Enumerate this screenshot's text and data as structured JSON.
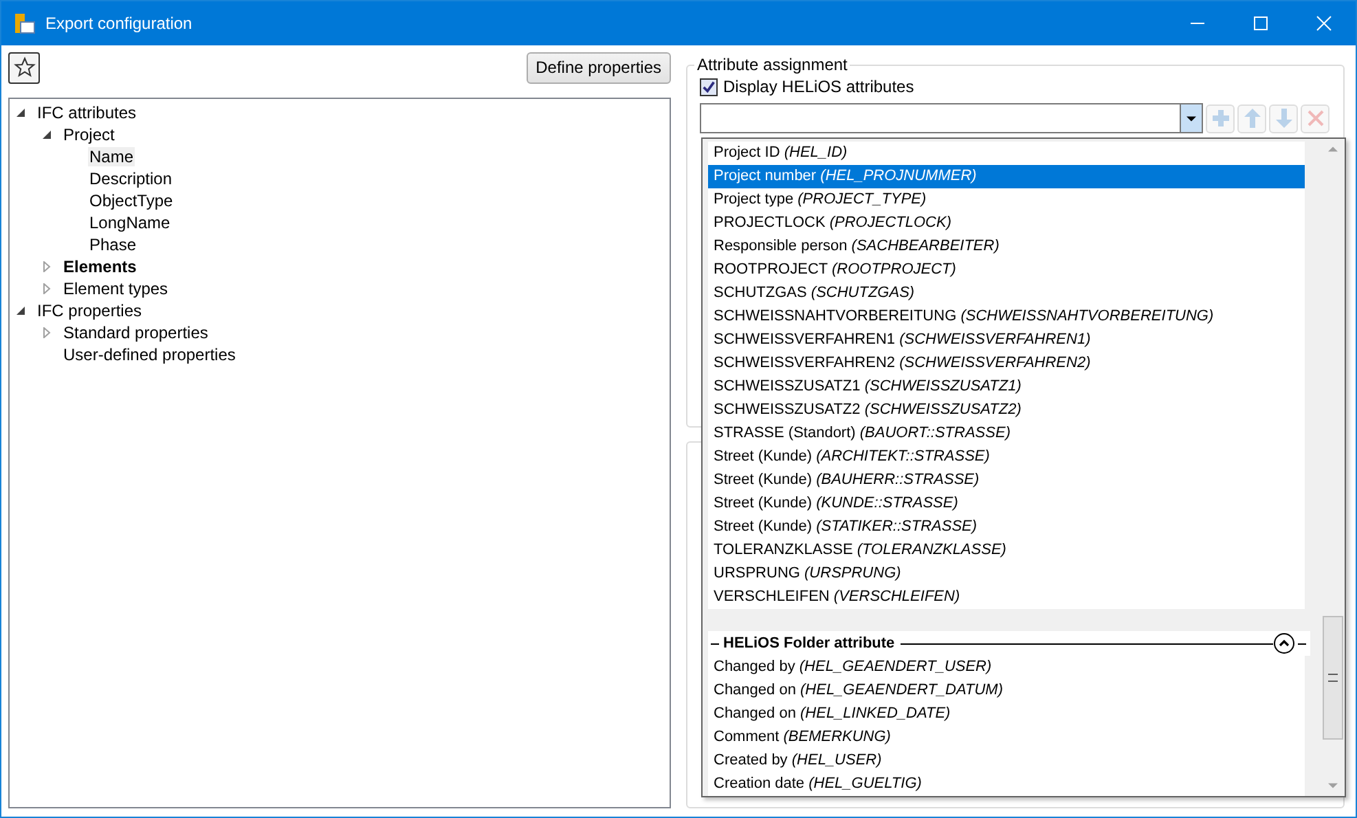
{
  "window": {
    "title": "Export configuration"
  },
  "toolbar": {
    "define_button": "Define properties"
  },
  "tree": [
    {
      "label": "IFC attributes",
      "bold": false,
      "selected": false,
      "expanded": true,
      "children": [
        {
          "label": "Project",
          "bold": false,
          "selected": false,
          "expanded": true,
          "children": [
            {
              "label": "Name",
              "bold": false,
              "selected": true
            },
            {
              "label": "Description",
              "bold": false,
              "selected": false
            },
            {
              "label": "ObjectType",
              "bold": false,
              "selected": false
            },
            {
              "label": "LongName",
              "bold": false,
              "selected": false
            },
            {
              "label": "Phase",
              "bold": false,
              "selected": false
            }
          ]
        },
        {
          "label": "Elements",
          "bold": true,
          "selected": false,
          "expanded": false
        },
        {
          "label": "Element types",
          "bold": false,
          "selected": false,
          "expanded": false
        }
      ]
    },
    {
      "label": "IFC properties",
      "bold": false,
      "selected": false,
      "expanded": true,
      "children": [
        {
          "label": "Standard properties",
          "bold": false,
          "selected": false,
          "expanded": false
        },
        {
          "label": "User-defined properties",
          "bold": false,
          "selected": false
        }
      ]
    }
  ],
  "attribute_assignment": {
    "title": "Attribute assignment",
    "display_checkbox": {
      "label": "Display HELiOS attributes",
      "checked": true
    },
    "tool_buttons": [
      {
        "kind": "add",
        "disabled": true
      },
      {
        "kind": "up",
        "disabled": true
      },
      {
        "kind": "down",
        "disabled": true
      },
      {
        "kind": "delete",
        "disabled": true
      }
    ]
  },
  "dropdown": {
    "sections": [
      {
        "items": [
          {
            "text": "Project ID *(HEL_ID)*",
            "selected": false
          },
          {
            "text": "Project number *(HEL_PROJNUMMER)*",
            "selected": true
          },
          {
            "text": "Project type *(PROJECT_TYPE)*",
            "selected": false
          },
          {
            "text": "PROJECTLOCK *(PROJECTLOCK)*",
            "selected": false
          },
          {
            "text": "Responsible person *(SACHBEARBEITER)*",
            "selected": false
          },
          {
            "text": "ROOTPROJECT *(ROOTPROJECT)*",
            "selected": false
          },
          {
            "text": "SCHUTZGAS *(SCHUTZGAS)*",
            "selected": false
          },
          {
            "text": "SCHWEISSNAHTVORBEREITUNG *(SCHWEISSNAHTVORBEREITUNG)*",
            "selected": false
          },
          {
            "text": "SCHWEISSVERFAHREN1 *(SCHWEISSVERFAHREN1)*",
            "selected": false
          },
          {
            "text": "SCHWEISSVERFAHREN2 *(SCHWEISSVERFAHREN2)*",
            "selected": false
          },
          {
            "text": "SCHWEISSZUSATZ1 *(SCHWEISSZUSATZ1)*",
            "selected": false
          },
          {
            "text": "SCHWEISSZUSATZ2 *(SCHWEISSZUSATZ2)*",
            "selected": false
          },
          {
            "text": "STRASSE (Standort) *(BAUORT::STRASSE)*",
            "selected": false
          },
          {
            "text": "Street (Kunde) *(ARCHITEKT::STRASSE)*",
            "selected": false
          },
          {
            "text": "Street (Kunde) *(BAUHERR::STRASSE)*",
            "selected": false
          },
          {
            "text": "Street (Kunde) *(KUNDE::STRASSE)*",
            "selected": false
          },
          {
            "text": "Street (Kunde) *(STATIKER::STRASSE)*",
            "selected": false
          },
          {
            "text": "TOLERANZKLASSE *(TOLERANZKLASSE)*",
            "selected": false
          },
          {
            "text": "URSPRUNG *(URSPRUNG)*",
            "selected": false
          },
          {
            "text": "VERSCHLEIFEN *(VERSCHLEIFEN)*",
            "selected": false
          }
        ]
      },
      {
        "title": "HELiOS Folder attribute",
        "expanded": true,
        "items": [
          {
            "text": "Changed by *(HEL_GEAENDERT_USER)*",
            "selected": false
          },
          {
            "text": "Changed on *(HEL_GEAENDERT_DATUM)*",
            "selected": false
          },
          {
            "text": "Changed on *(HEL_LINKED_DATE)*",
            "selected": false
          },
          {
            "text": "Comment *(BEMERKUNG)*",
            "selected": false
          },
          {
            "text": "Created by *(HEL_USER)*",
            "selected": false
          },
          {
            "text": "Creation date *(HEL_GUELTIG)*",
            "selected": false
          }
        ]
      }
    ]
  }
}
